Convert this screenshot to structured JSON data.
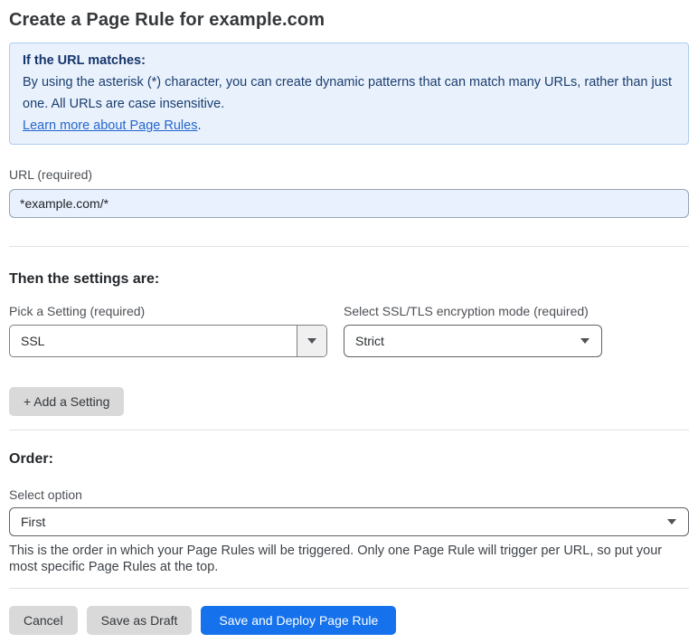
{
  "page_title": "Create a Page Rule for example.com",
  "info_box": {
    "heading": "If the URL matches:",
    "body": "By using the asterisk (*) character, you can create dynamic patterns that can match many URLs, rather than just one. All URLs are case insensitive.",
    "link_label": "Learn more about Page Rules",
    "link_suffix": "."
  },
  "url_field": {
    "label": "URL (required)",
    "value": "*example.com/*"
  },
  "settings_section": {
    "heading": "Then the settings are:",
    "setting_select": {
      "label": "Pick a Setting (required)",
      "value": "SSL"
    },
    "mode_select": {
      "label": "Select SSL/TLS encryption mode (required)",
      "value": "Strict"
    },
    "add_setting_button": "+ Add a Setting"
  },
  "order_section": {
    "heading": "Order:",
    "select_label": "Select option",
    "select_value": "First",
    "help_text": "This is the order in which your Page Rules will be triggered. Only one Page Rule will trigger per URL, so put your most specific Page Rules at the top."
  },
  "footer": {
    "cancel_label": "Cancel",
    "save_draft_label": "Save as Draft",
    "save_deploy_label": "Save and Deploy Page Rule"
  },
  "colors": {
    "accent_blue": "#1672ec",
    "info_background": "#e9f2fc",
    "info_border": "#aecbef",
    "info_text": "#1b3d6f",
    "link_blue": "#2565ce",
    "url_input_background": "#e8f1fd",
    "gray_button": "#d9d9d9"
  },
  "icons": {
    "dropdown_arrow": "caret-down"
  }
}
